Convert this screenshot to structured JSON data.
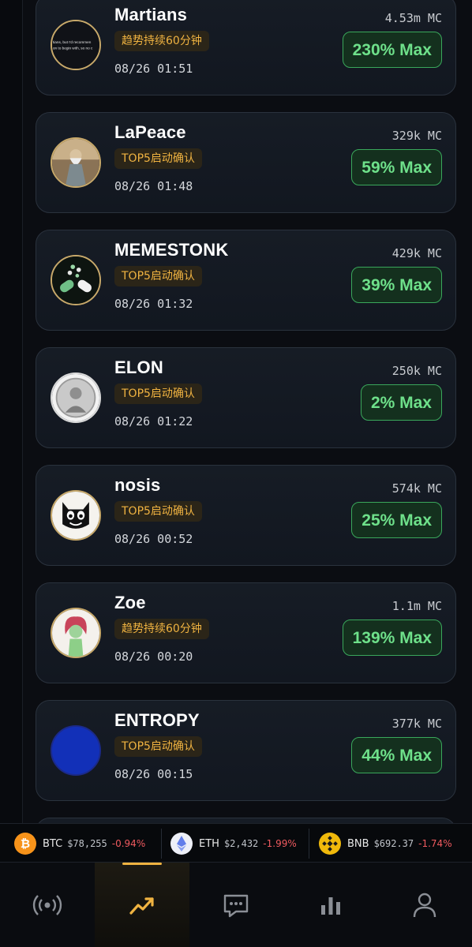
{
  "feed": {
    "items": [
      {
        "name": "Martians",
        "tag": "趋势持续60分钟",
        "time": "08/26 01:51",
        "mc": "4.53m MC",
        "max": "230% Max",
        "avatar_text_1": "tians, but I'd recommen",
        "avatar_text_2": "on to begin with, so no c",
        "icon": "martians-avatar-icon"
      },
      {
        "name": "LaPeace",
        "tag": "TOP5启动确认",
        "time": "08/26 01:48",
        "mc": "329k MC",
        "max": "59% Max",
        "icon": "sage-avatar-icon"
      },
      {
        "name": "MEMESTONK",
        "tag": "TOP5启动确认",
        "time": "08/26 01:32",
        "mc": "429k MC",
        "max": "39% Max",
        "icon": "pill-avatar-icon"
      },
      {
        "name": "ELON",
        "tag": "TOP5启动确认",
        "time": "08/26 01:22",
        "mc": "250k MC",
        "max": "2% Max",
        "icon": "coin-face-avatar-icon"
      },
      {
        "name": "nosis",
        "tag": "TOP5启动确认",
        "time": "08/26 00:52",
        "mc": "574k MC",
        "max": "25% Max",
        "icon": "cat-avatar-icon"
      },
      {
        "name": "Zoe",
        "tag": "趋势持续60分钟",
        "time": "08/26 00:20",
        "mc": "1.1m MC",
        "max": "139% Max",
        "icon": "girl-avatar-icon"
      },
      {
        "name": "ENTROPY",
        "tag": "TOP5启动确认",
        "time": "08/26 00:15",
        "mc": "377k MC",
        "max": "44% Max",
        "icon": "blue-circle-avatar-icon"
      }
    ]
  },
  "ticker": [
    {
      "symbol": "BTC",
      "price": "$78,255",
      "change": "-0.94%",
      "icon": "bitcoin-icon",
      "color": "#f7931a"
    },
    {
      "symbol": "ETH",
      "price": "$2,432",
      "change": "-1.99%",
      "icon": "ethereum-icon",
      "color": "#627eea"
    },
    {
      "symbol": "BNB",
      "price": "$692.37",
      "change": "-1.74%",
      "icon": "bnb-icon",
      "color": "#f0b90b"
    }
  ],
  "nav": [
    {
      "icon": "broadcast-icon",
      "active": false
    },
    {
      "icon": "trend-icon",
      "active": true
    },
    {
      "icon": "chat-icon",
      "active": false
    },
    {
      "icon": "bar-chart-icon",
      "active": false
    },
    {
      "icon": "profile-icon",
      "active": false
    }
  ],
  "colors": {
    "accent": "#f0b341",
    "positive": "#6ee08a",
    "negative": "#ef5a5f"
  }
}
